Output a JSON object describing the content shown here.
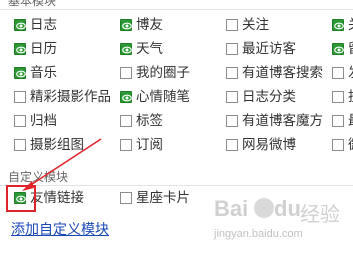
{
  "sections": {
    "basic_title": "基本模块",
    "custom_title": "自定义模块"
  },
  "basic_modules": [
    {
      "label": "日志",
      "checked": true
    },
    {
      "label": "博友",
      "checked": true
    },
    {
      "label": "关注",
      "checked": false
    },
    {
      "label": "关",
      "checked": true
    },
    {
      "label": "日历",
      "checked": true
    },
    {
      "label": "天气",
      "checked": true
    },
    {
      "label": "最近访客",
      "checked": false
    },
    {
      "label": "留",
      "checked": true
    },
    {
      "label": "音乐",
      "checked": true
    },
    {
      "label": "我的圈子",
      "checked": false
    },
    {
      "label": "有道博客搜索",
      "checked": false
    },
    {
      "label": "发",
      "checked": false
    },
    {
      "label": "精彩摄影作品",
      "checked": false
    },
    {
      "label": "心情随笔",
      "checked": true
    },
    {
      "label": "日志分类",
      "checked": false
    },
    {
      "label": "投",
      "checked": false
    },
    {
      "label": "归档",
      "checked": false
    },
    {
      "label": "标签",
      "checked": false
    },
    {
      "label": "有道博客魔方",
      "checked": false
    },
    {
      "label": "最",
      "checked": false
    },
    {
      "label": "摄影组图",
      "checked": false
    },
    {
      "label": "订阅",
      "checked": false
    },
    {
      "label": "网易微博",
      "checked": false
    },
    {
      "label": "微",
      "checked": false
    }
  ],
  "custom_modules": [
    {
      "label": "友情链接",
      "checked": true
    },
    {
      "label": "星座卡片",
      "checked": false
    }
  ],
  "add_custom_link": "添加自定义模块",
  "watermark": {
    "brand": "Bai",
    "paw": "du",
    "suffix": "经验",
    "url": "jingyan.baidu.com"
  },
  "colors": {
    "checked_green": "#2b9a35",
    "link_blue": "#1a47b8",
    "annotation_red": "#e0222a"
  }
}
